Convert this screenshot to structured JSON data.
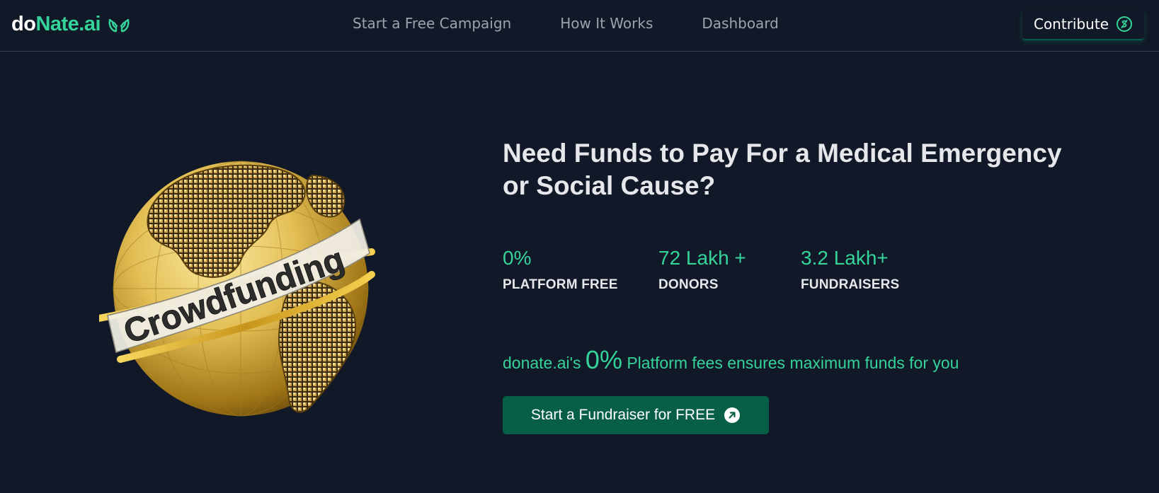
{
  "brand": {
    "logo_prefix": "do",
    "logo_suffix": "Nate.ai",
    "accent_color": "#34d399",
    "dark_green": "#065f46",
    "background": "#111827"
  },
  "nav": {
    "links": [
      {
        "label": "Start a Free Campaign"
      },
      {
        "label": "How It Works"
      },
      {
        "label": "Dashboard"
      }
    ],
    "contribute_label": "Contribute",
    "contribute_icon": "dollar-circle-icon"
  },
  "hero": {
    "image_text": "Crowdfunding",
    "headline": "Need Funds to Pay For a Medical Emergency or Social Cause?",
    "stats": [
      {
        "value": "0%",
        "label": "PLATFORM FREE"
      },
      {
        "value": "72 Lakh +",
        "label": "DONORS"
      },
      {
        "value": "3.2 Lakh+",
        "label": "FUNDRAISERS"
      }
    ],
    "tagline_prefix": "donate.ai's ",
    "tagline_highlight": "0%",
    "tagline_suffix": " Platform fees ensures maximum funds for you",
    "cta_label": "Start a Fundraiser for FREE",
    "cta_icon": "arrow-up-right-circle-icon"
  }
}
